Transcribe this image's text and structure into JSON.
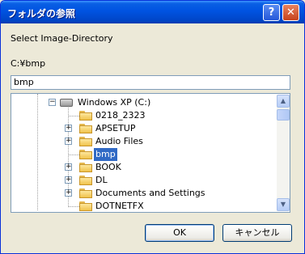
{
  "window": {
    "title": "フォルダの参照",
    "help_label": "?",
    "close_label": "✕"
  },
  "dialog": {
    "prompt": "Select Image-Directory",
    "current_path": "C:¥bmp",
    "folder_input_value": "bmp"
  },
  "tree": {
    "items": [
      {
        "label": "Windows XP (C:)",
        "expander": "−",
        "icon": "drive-icon"
      },
      {
        "label": "0218_2323",
        "expander": "",
        "icon": "folder-icon"
      },
      {
        "label": "APSETUP",
        "expander": "+",
        "icon": "folder-icon"
      },
      {
        "label": "Audio Files",
        "expander": "+",
        "icon": "folder-icon"
      },
      {
        "label": "bmp",
        "expander": "",
        "icon": "folder-icon",
        "selected": true
      },
      {
        "label": "BOOK",
        "expander": "+",
        "icon": "folder-icon"
      },
      {
        "label": "DL",
        "expander": "+",
        "icon": "folder-icon"
      },
      {
        "label": "Documents and Settings",
        "expander": "+",
        "icon": "folder-icon"
      },
      {
        "label": "DOTNETFX",
        "expander": "",
        "icon": "folder-icon"
      }
    ]
  },
  "scrollbar": {
    "up_arrow": "▲",
    "down_arrow": "▼"
  },
  "buttons": {
    "ok_label": "OK",
    "cancel_label": "キャンセル"
  },
  "colors": {
    "titlebar": "#0053e1",
    "selection": "#316ac5",
    "face": "#ece9d8"
  }
}
